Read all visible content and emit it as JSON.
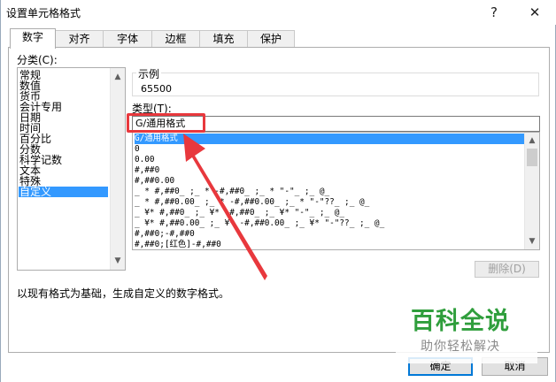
{
  "window": {
    "title": "设置单元格格式",
    "help_glyph": "?",
    "close_glyph": "✕"
  },
  "tabs": [
    {
      "label": "数字",
      "active": true
    },
    {
      "label": "对齐",
      "active": false
    },
    {
      "label": "字体",
      "active": false
    },
    {
      "label": "边框",
      "active": false
    },
    {
      "label": "填充",
      "active": false
    },
    {
      "label": "保护",
      "active": false
    }
  ],
  "category": {
    "label": "分类(C):",
    "items": [
      "常规",
      "数值",
      "货币",
      "会计专用",
      "日期",
      "时间",
      "百分比",
      "分数",
      "科学记数",
      "文本",
      "特殊",
      "自定义"
    ],
    "selected": "自定义"
  },
  "sample": {
    "label": "示例",
    "value": "65500"
  },
  "type": {
    "label": "类型(T):",
    "value": "G/通用格式",
    "items": [
      "G/通用格式",
      "0",
      "0.00",
      "#,##0",
      "#,##0.00",
      "_ * #,##0_ ;_ * -#,##0_ ;_ * \"-\"_ ;_ @_",
      "_ * #,##0.00_ ;_ * -#,##0.00_ ;_ * \"-\"??_ ;_ @_",
      "_ ¥* #,##0_ ;_ ¥* -#,##0_ ;_ ¥* \"-\"_ ;_ @_",
      "_ ¥* #,##0.00_ ;_ ¥* -#,##0.00_ ;_ ¥* \"-\"??_ ;_ @_",
      "#,##0;-#,##0",
      "#,##0;[红色]-#,##0"
    ]
  },
  "buttons": {
    "delete": "删除(D)",
    "ok": "确定",
    "cancel": "取消"
  },
  "description": "以现有格式为基础，生成自定义的数字格式。",
  "watermark": {
    "main": "百科全说",
    "sub": "助你轻松解决"
  },
  "colors": {
    "selection": "#3399ff",
    "annotation_red": "#e8383d",
    "watermark_green": "#2f9e3c"
  },
  "icons": {
    "scroll_up": "▲",
    "scroll_down": "▼"
  }
}
